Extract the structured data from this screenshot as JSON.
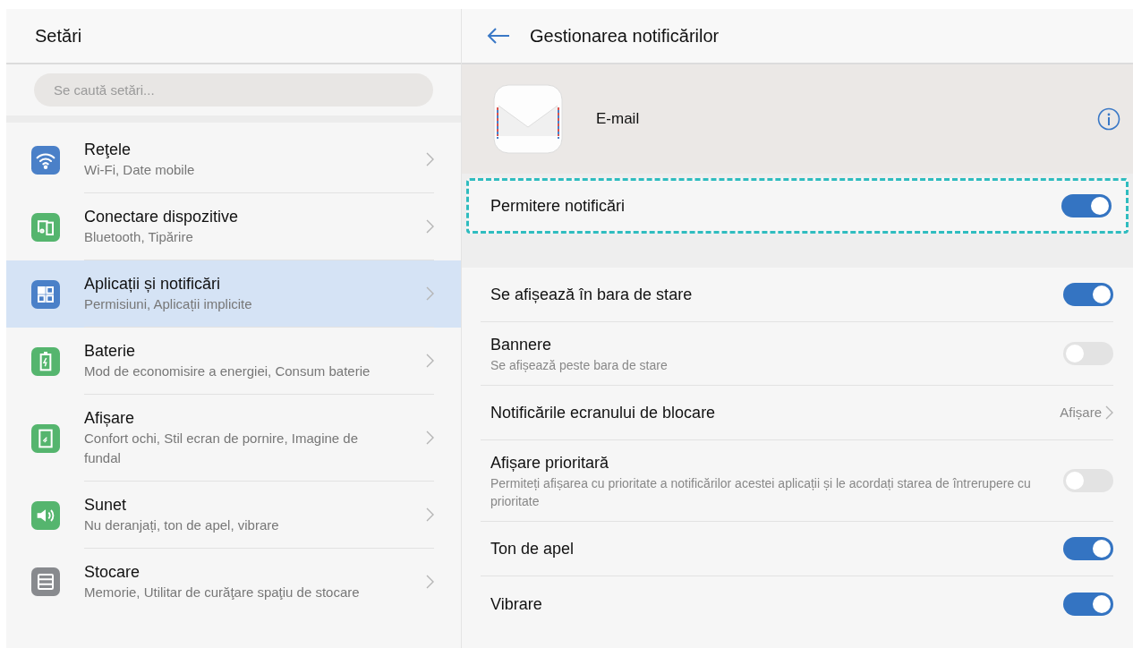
{
  "sidebar": {
    "title": "Setări",
    "search": {
      "placeholder": "Se caută setări..."
    },
    "items": [
      {
        "title": "Reţele",
        "subtitle": "Wi-Fi, Date mobile",
        "selected": false
      },
      {
        "title": "Conectare dispozitive",
        "subtitle": "Bluetooth, Tipărire",
        "selected": false
      },
      {
        "title": "Aplicații și notificări",
        "subtitle": "Permisiuni, Aplicații implicite",
        "selected": true
      },
      {
        "title": "Baterie",
        "subtitle": "Mod de economisire a energiei, Consum baterie",
        "selected": false
      },
      {
        "title": "Afișare",
        "subtitle": "Confort ochi, Stil ecran de pornire, Imagine de fundal",
        "selected": false
      },
      {
        "title": "Sunet",
        "subtitle": "Nu deranjați, ton de apel, vibrare",
        "selected": false
      },
      {
        "title": "Stocare",
        "subtitle": "Memorie, Utilitar de curăţare spaţiu de stocare",
        "selected": false
      }
    ]
  },
  "detail": {
    "title": "Gestionarea notificărilor",
    "app": {
      "name": "E-mail"
    },
    "main_toggle": {
      "label": "Permitere notificări",
      "on": true,
      "highlighted": true
    },
    "settings": [
      {
        "kind": "toggle",
        "label": "Se afișează în bara de stare",
        "on": true
      },
      {
        "kind": "toggle",
        "label": "Bannere",
        "subtitle": "Se afișează peste bara de stare",
        "on": false
      },
      {
        "kind": "link",
        "label": "Notificările ecranului de blocare",
        "value": "Afișare"
      },
      {
        "kind": "toggle",
        "label": "Afișare prioritară",
        "subtitle": "Permiteți afișarea cu prioritate a notificărilor acestei aplicații și le acordați starea de întrerupere cu prioritate",
        "on": false
      },
      {
        "kind": "toggle",
        "label": "Ton de apel",
        "on": true
      },
      {
        "kind": "toggle",
        "label": "Vibrare",
        "on": true
      }
    ]
  }
}
